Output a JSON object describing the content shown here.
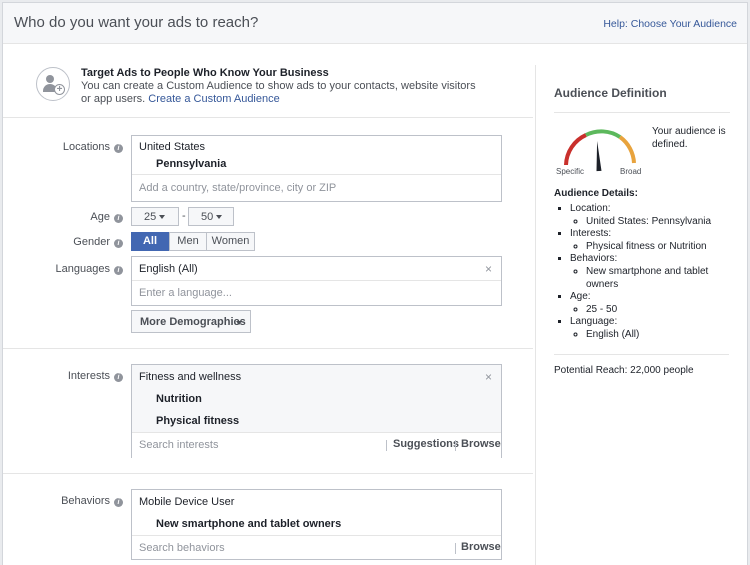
{
  "header": {
    "title": "Who do you want your ads to reach?",
    "help_link": "Help: Choose Your Audience"
  },
  "custom_audience": {
    "title": "Target Ads to People Who Know Your Business",
    "description": "You can create a Custom Audience to show ads to your contacts, website visitors or app users.",
    "link": "Create a Custom Audience",
    "icon": "custom-audience-icon"
  },
  "locations": {
    "label": "Locations",
    "country": "United States",
    "region": "Pennsylvania",
    "placeholder": "Add a country, state/province, city or ZIP"
  },
  "age": {
    "label": "Age",
    "min": "25",
    "max": "50",
    "separator": "-"
  },
  "gender": {
    "label": "Gender",
    "options": [
      "All",
      "Men",
      "Women"
    ],
    "selected": "All"
  },
  "languages": {
    "label": "Languages",
    "value": "English (All)",
    "placeholder": "Enter a language..."
  },
  "more_demographics": {
    "label": "More Demographics"
  },
  "interests": {
    "label": "Interests",
    "category": "Fitness and wellness",
    "items": [
      "Nutrition",
      "Physical fitness"
    ],
    "placeholder": "Search interests",
    "suggestions": "Suggestions",
    "browse": "Browse"
  },
  "behaviors": {
    "label": "Behaviors",
    "category": "Mobile Device User",
    "items": [
      "New smartphone and tablet owners"
    ],
    "placeholder": "Search behaviors",
    "browse": "Browse"
  },
  "audience_definition": {
    "title": "Audience Definition",
    "status": "Your audience is defined.",
    "gauge_specific": "Specific",
    "gauge_broad": "Broad",
    "gauge_level": 0.48,
    "details_title": "Audience Details:",
    "details": [
      {
        "label": "Location:",
        "value": "United States: Pennsylvania"
      },
      {
        "label": "Interests:",
        "value": "Physical fitness or Nutrition"
      },
      {
        "label": "Behaviors:",
        "value": "New smartphone and tablet owners"
      },
      {
        "label": "Age:",
        "value": "25 - 50"
      },
      {
        "label": "Language:",
        "value": "English (All)"
      }
    ],
    "reach": "Potential Reach: 22,000 people"
  },
  "colors": {
    "accent": "#4267b2",
    "link": "#365899",
    "gauge_red": "#c9302c",
    "gauge_green": "#5cb85c",
    "gauge_amber": "#e8a33d"
  }
}
